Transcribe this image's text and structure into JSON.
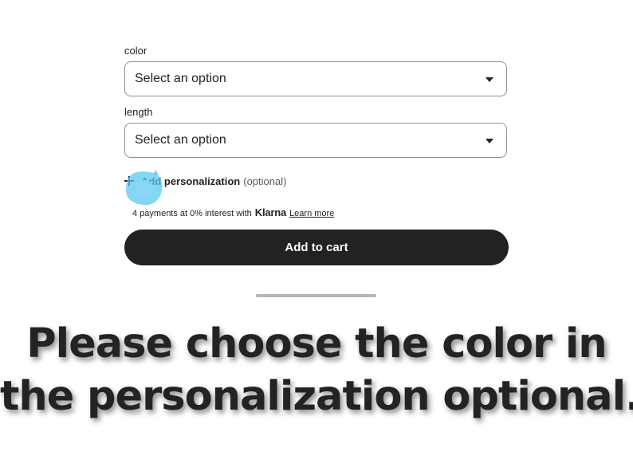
{
  "form": {
    "color": {
      "label": "color",
      "value": "Select an option"
    },
    "length": {
      "label": "length",
      "value": "Select an option"
    },
    "personalization": {
      "label": "Add personalization",
      "optional": "(optional)"
    },
    "financing": {
      "text": "4 payments at 0% interest with",
      "brand": "Klarna",
      "link": "Learn more"
    },
    "add_to_cart": "Add to cart"
  },
  "caption": {
    "line1": "Please choose the color in",
    "line2": "the personalization optional."
  },
  "icons": {
    "dropdown": "chevron-down-icon",
    "plus": "plus-icon",
    "tap": "tap-highlight-icon"
  },
  "colors": {
    "button_bg": "#222222",
    "button_text": "#ffffff",
    "border": "#8f8f8f",
    "tap_highlight": "#5ac8f0"
  }
}
